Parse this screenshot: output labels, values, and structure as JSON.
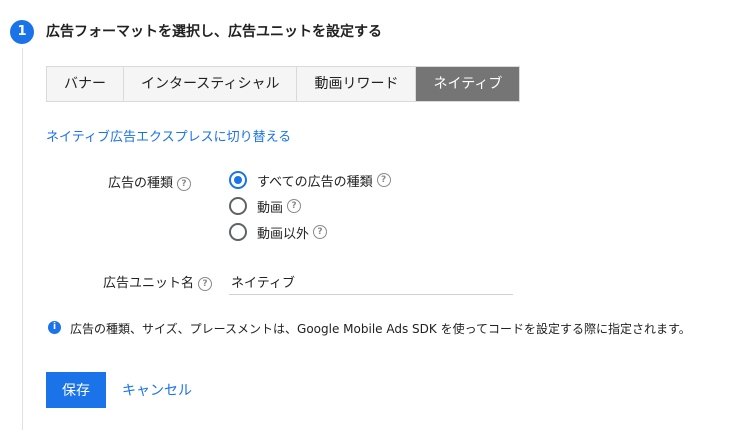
{
  "step": {
    "number": "1",
    "title": "広告フォーマットを選択し、広告ユニットを設定する"
  },
  "format_tabs": [
    {
      "label": "バナー",
      "active": false
    },
    {
      "label": "インタースティシャル",
      "active": false
    },
    {
      "label": "動画リワード",
      "active": false
    },
    {
      "label": "ネイティブ",
      "active": true
    }
  ],
  "switch_link": "ネイティブ広告エクスプレスに切り替える",
  "ad_type": {
    "label": "広告の種類",
    "options": [
      {
        "label": "すべての広告の種類",
        "checked": true
      },
      {
        "label": "動画",
        "checked": false
      },
      {
        "label": "動画以外",
        "checked": false
      }
    ]
  },
  "unit_name": {
    "label": "広告ユニット名",
    "value": "ネイティブ"
  },
  "info": "広告の種類、サイズ、プレースメントは、Google Mobile Ads SDK を使ってコードを設定する際に指定されます。",
  "actions": {
    "save": "保存",
    "cancel": "キャンセル"
  },
  "colors": {
    "accent": "#1a73e8",
    "active_tab": "#757575"
  }
}
